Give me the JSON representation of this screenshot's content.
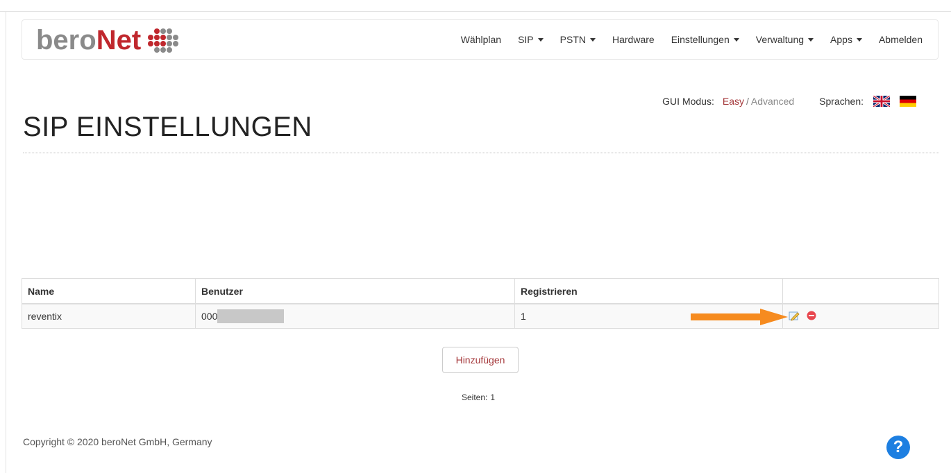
{
  "brand": {
    "part1": "bero",
    "part2": "Net",
    "dot_colors": [
      "#c0272d",
      "#8a8a8a"
    ]
  },
  "nav": {
    "items": [
      {
        "label": "Wählplan",
        "dropdown": false
      },
      {
        "label": "SIP",
        "dropdown": true
      },
      {
        "label": "PSTN",
        "dropdown": true
      },
      {
        "label": "Hardware",
        "dropdown": false
      },
      {
        "label": "Einstellungen",
        "dropdown": true
      },
      {
        "label": "Verwaltung",
        "dropdown": true
      },
      {
        "label": "Apps",
        "dropdown": true
      },
      {
        "label": "Abmelden",
        "dropdown": false
      }
    ]
  },
  "gui_mode": {
    "label": "GUI Modus:",
    "easy": "Easy",
    "separator": "/",
    "advanced": "Advanced"
  },
  "languages": {
    "label": "Sprachen:",
    "flags": [
      "uk-flag",
      "german-flag"
    ]
  },
  "page_title": "SIP EINSTELLUNGEN",
  "table": {
    "headers": [
      "Name",
      "Benutzer",
      "Registrieren",
      ""
    ],
    "rows": [
      {
        "name": "reventix",
        "user_visible": "000",
        "register": "1",
        "actions": [
          "edit-icon",
          "delete-icon"
        ]
      }
    ]
  },
  "add_button": "Hinzufügen",
  "pagination": {
    "label": "Seiten:",
    "pages": "1"
  },
  "footer": {
    "copyright": "Copyright © 2020 beroNet GmbH, Germany",
    "help": "?"
  },
  "colors": {
    "accent": "#a4373a",
    "brand_red": "#c0272d",
    "help_blue": "#1d7fe1",
    "arrow_orange": "#f68b1f"
  }
}
